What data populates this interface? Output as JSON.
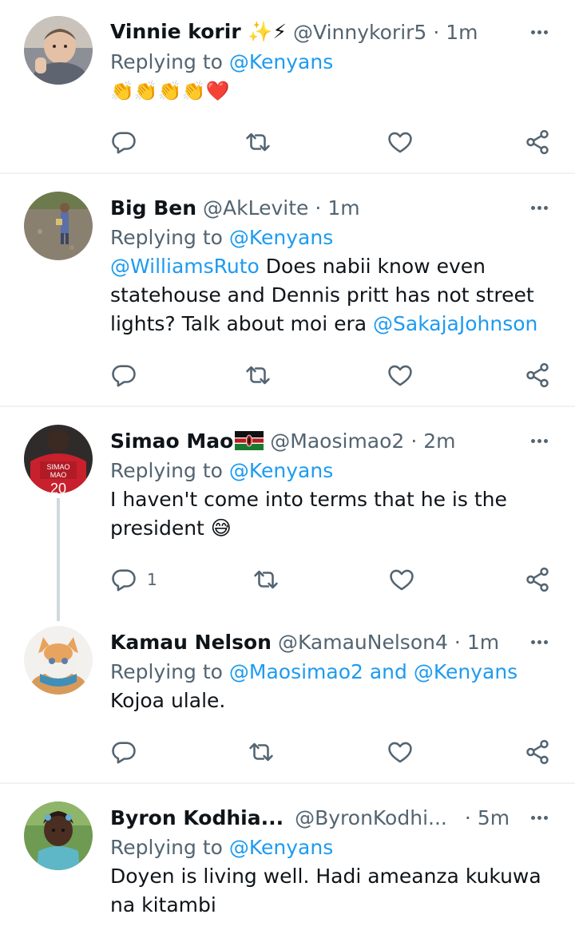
{
  "tweets": [
    {
      "name": "Vinnie korir ✨⚡",
      "handle": "@Vinnykorir5",
      "dot": "·",
      "time": "1m",
      "replying_prefix": "Replying to ",
      "replying_to": "@Kenyans",
      "body": "👏👏👏👏❤️",
      "avatar_icon": "baby-photo-avatar"
    },
    {
      "name": "Big Ben",
      "handle": "@AkLevite",
      "dot": "·",
      "time": "1m",
      "replying_prefix": "Replying to ",
      "replying_to": "@Kenyans",
      "body_mention_1": "@WilliamsRuto",
      "body_text_1": " Does nabii know even statehouse and Dennis pritt has not street lights? Talk about moi era ",
      "body_mention_2": "@SakajaJohnson",
      "avatar_icon": "field-photo-avatar"
    },
    {
      "name": "Simao Mao",
      "handle": "@Maosimao2",
      "dot": "·",
      "time": "2m",
      "replying_prefix": "Replying to ",
      "replying_to": "@Kenyans",
      "body": "I haven't come into terms that he is the president 😅",
      "reply_count": "1",
      "avatar_icon": "jersey-photo-avatar",
      "flag_icon": "kenya-flag-icon"
    },
    {
      "name": "Kamau Nelson",
      "handle": "@KamauNelson4",
      "dot": "·",
      "time": "1m",
      "replying_prefix": "Replying to ",
      "replying_to": "@Maosimao2 and @Kenyans",
      "body": "Kojoa ulale.",
      "avatar_icon": "cat-photo-avatar"
    },
    {
      "name": "Byron Kodhia...",
      "handle": "@ByronKodhi...",
      "dot": "·",
      "time": "5m",
      "replying_prefix": "Replying to ",
      "replying_to": "@Kenyans",
      "body": "Doyen is living well. Hadi ameanza kukuwa na kitambi",
      "avatar_icon": "child-photo-avatar"
    }
  ],
  "colors": {
    "accent": "#1d9bf0",
    "secondary_text": "#536471",
    "divider": "#eff3f4"
  }
}
